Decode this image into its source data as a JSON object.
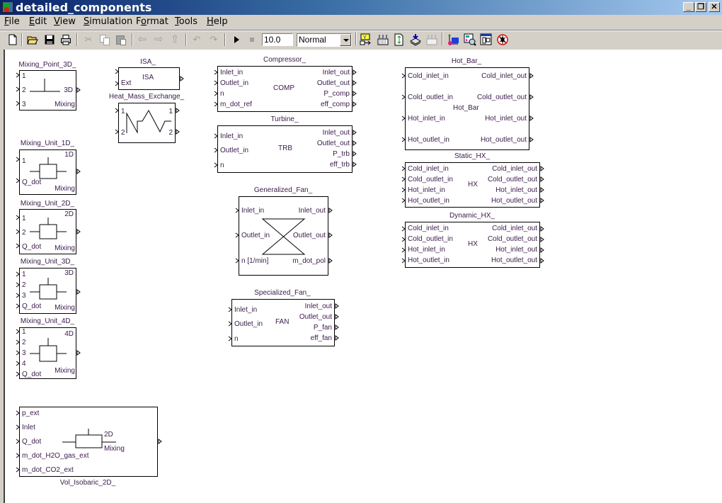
{
  "window": {
    "title": "detailed_components",
    "controls": [
      "minimize",
      "restore",
      "close"
    ]
  },
  "menubar": {
    "items": [
      {
        "label": "File",
        "accel": "F"
      },
      {
        "label": "Edit",
        "accel": "E"
      },
      {
        "label": "View",
        "accel": "V"
      },
      {
        "label": "Simulation",
        "accel": "S"
      },
      {
        "label": "Format",
        "accel": "o"
      },
      {
        "label": "Tools",
        "accel": "T"
      },
      {
        "label": "Help",
        "accel": "H"
      }
    ]
  },
  "toolbar": {
    "icons": [
      "new-icon",
      "open-icon",
      "save-icon",
      "print-icon",
      "cut-icon",
      "copy-icon",
      "paste-icon",
      "back-icon",
      "forward-icon",
      "up-icon",
      "undo-icon",
      "redo-icon",
      "start-icon",
      "stop-icon",
      "library-browser-icon",
      "build-icon",
      "update-diagram-icon",
      "incremental-build-icon",
      "stop-build-icon",
      "model-explorer-icon",
      "model-advisor-icon",
      "subsystem-icon",
      "debugger-icon"
    ],
    "stop_time": "10.0",
    "sim_mode": "Normal"
  },
  "blocks": {
    "mixing_point_3d": {
      "name": "Mixing_Point_3D_",
      "inputs": [
        "1",
        "2",
        "3"
      ],
      "center": "3D",
      "footer": "Mixing"
    },
    "isa": {
      "name": "ISA_",
      "inputs": [
        "",
        "Ext"
      ],
      "center": "ISA"
    },
    "heat_mass_exchange": {
      "name": "Heat_Mass_Exchange_",
      "inputs": [
        "1",
        "2"
      ],
      "outputs": [
        "1",
        "2"
      ]
    },
    "compressor": {
      "name": "Compressor_",
      "inputs": [
        "Inlet_in",
        "Outlet_in",
        "n",
        "m_dot_ref"
      ],
      "outputs": [
        "Inlet_out",
        "Outlet_out",
        "P_comp",
        "eff_comp"
      ],
      "center": "COMP"
    },
    "turbine": {
      "name": "Turbine_",
      "inputs": [
        "Inlet_in",
        "Outlet_in",
        "n"
      ],
      "outputs": [
        "Inlet_out",
        "Outlet_out",
        "P_trb",
        "eff_trb"
      ],
      "center": "TRB"
    },
    "generalized_fan": {
      "name": "Generalized_Fan_",
      "inputs": [
        "Inlet_in",
        "Outlet_in",
        "n [1/min]"
      ],
      "outputs": [
        "Inlet_out",
        "Outlet_out",
        "m_dot_pol"
      ]
    },
    "specialized_fan": {
      "name": "Specialized_Fan_",
      "inputs": [
        "Inlet_in",
        "Outlet_in",
        "n"
      ],
      "outputs": [
        "Inlet_out",
        "Outlet_out",
        "P_fan",
        "eff_fan"
      ],
      "center": "FAN"
    },
    "hot_bar": {
      "name": "Hot_Bar_",
      "inputs": [
        "Cold_inlet_in",
        "Cold_outlet_in",
        "Hot_inlet_in",
        "Hot_outlet_in"
      ],
      "outputs": [
        "Cold_inlet_out",
        "Cold_outlet_out",
        "Hot_inlet_out",
        "Hot_outlet_out"
      ],
      "center": "Hot_Bar"
    },
    "static_hx": {
      "name": "Static_HX_",
      "inputs": [
        "Cold_inlet_in",
        "Cold_outlet_in",
        "Hot_inlet_in",
        "Hot_outlet_in"
      ],
      "outputs": [
        "Cold_inlet_out",
        "Cold_outlet_out",
        "Hot_inlet_out",
        "Hot_outlet_out"
      ],
      "center": "HX"
    },
    "dynamic_hx": {
      "name": "Dynamic_HX_",
      "inputs": [
        "Cold_inlet_in",
        "Cold_outlet_in",
        "Hot_inlet_in",
        "Hot_outlet_in"
      ],
      "outputs": [
        "Cold_inlet_out",
        "Cold_outlet_out",
        "Hot_inlet_out",
        "Hot_outlet_out"
      ],
      "center": "HX"
    },
    "mixing_unit_1d": {
      "name": "Mixing_Unit_1D_",
      "inputs": [
        "1",
        "Q_dot"
      ],
      "center": "1D",
      "footer": "Mixing"
    },
    "mixing_unit_2d": {
      "name": "Mixing_Unit_2D_",
      "inputs": [
        "1",
        "2",
        "Q_dot"
      ],
      "center": "2D",
      "footer": "Mixing"
    },
    "mixing_unit_3d": {
      "name": "Mixing_Unit_3D_",
      "inputs": [
        "1",
        "2",
        "3",
        "Q_dot"
      ],
      "center": "3D",
      "footer": "Mixing"
    },
    "mixing_unit_4d": {
      "name": "Mixing_Unit_4D_",
      "inputs": [
        "1",
        "2",
        "3",
        "4",
        "Q_dot"
      ],
      "center": "4D",
      "footer": "Mixing"
    },
    "vol_isobaric_2d": {
      "name": "Vol_Isobaric_2D_",
      "inputs": [
        "p_ext",
        "Inlet",
        "Q_dot",
        "m_dot_H2O_gas_ext",
        "m_dot_CO2_ext"
      ],
      "center": "2D",
      "footer": "Mixing"
    }
  }
}
